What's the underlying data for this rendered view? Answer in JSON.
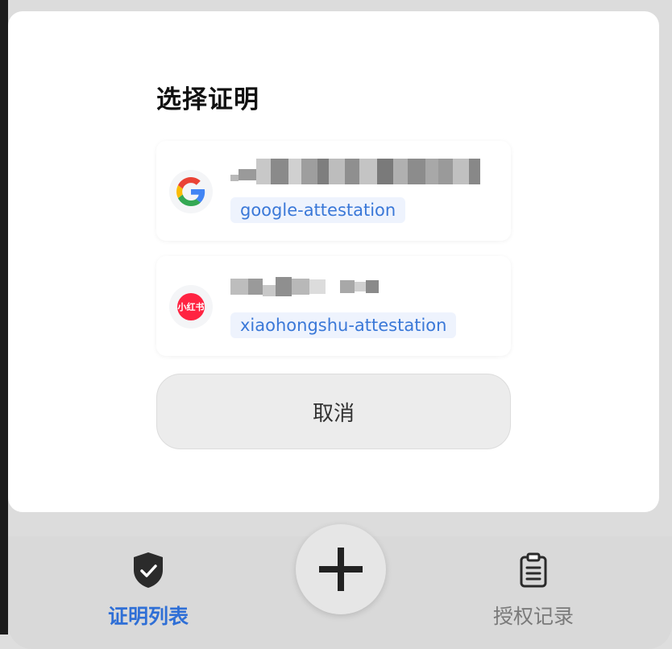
{
  "dialog": {
    "title": "选择证明",
    "cancel_label": "取消"
  },
  "attestations": [
    {
      "provider": "google",
      "icon": "google-logo-icon",
      "account_display": "(blurred email ending in …oook.com)",
      "tag": "google-attestation"
    },
    {
      "provider": "xiaohongshu",
      "icon": "xiaohongshu-logo-icon",
      "logo_text": "小红书",
      "account_display": "(blurred username)",
      "tag": "xiaohongshu-attestation"
    }
  ],
  "bottom_nav": {
    "left_label": "证明列表",
    "right_label": "授权记录",
    "add_icon": "plus-icon",
    "left_icon": "shield-check-icon",
    "right_icon": "clipboard-list-icon"
  },
  "colors": {
    "accent": "#2f6fd6",
    "tag_text": "#3a78d8",
    "tag_bg": "#eef3fd",
    "xiaohongshu_red": "#ff2442"
  }
}
